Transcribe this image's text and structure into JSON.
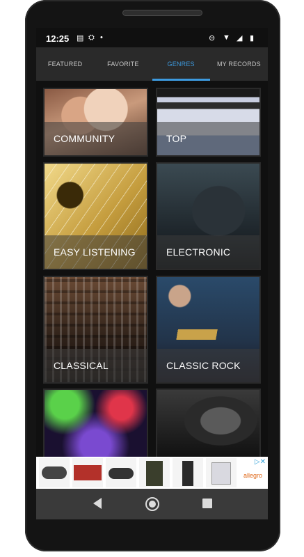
{
  "status_bar": {
    "time": "12:25",
    "left_icons": [
      "message-icon",
      "android-icon",
      "dot-icon"
    ],
    "right_icons": [
      "dnd-icon",
      "wifi-icon",
      "signal-icon",
      "battery-icon"
    ]
  },
  "tabs": [
    {
      "label": "FEATURED",
      "active": false
    },
    {
      "label": "FAVORITE",
      "active": false
    },
    {
      "label": "GENRES",
      "active": true
    },
    {
      "label": "MY RECORDS",
      "active": false
    }
  ],
  "genres": [
    {
      "label": "COMMUNITY"
    },
    {
      "label": "TOP"
    },
    {
      "label": "EASY LISTENING"
    },
    {
      "label": "ELECTRONIC"
    },
    {
      "label": "CLASSICAL"
    },
    {
      "label": "CLASSIC ROCK"
    },
    {
      "label": ""
    },
    {
      "label": ""
    }
  ],
  "ad": {
    "brand": "allegro",
    "products": [
      "motorcycle",
      "trailer",
      "motorcycle",
      "jacket",
      "pants",
      "machine"
    ]
  },
  "colors": {
    "accent": "#3d9be0",
    "tab_bar": "#2a2a2a",
    "background": "#101010"
  }
}
